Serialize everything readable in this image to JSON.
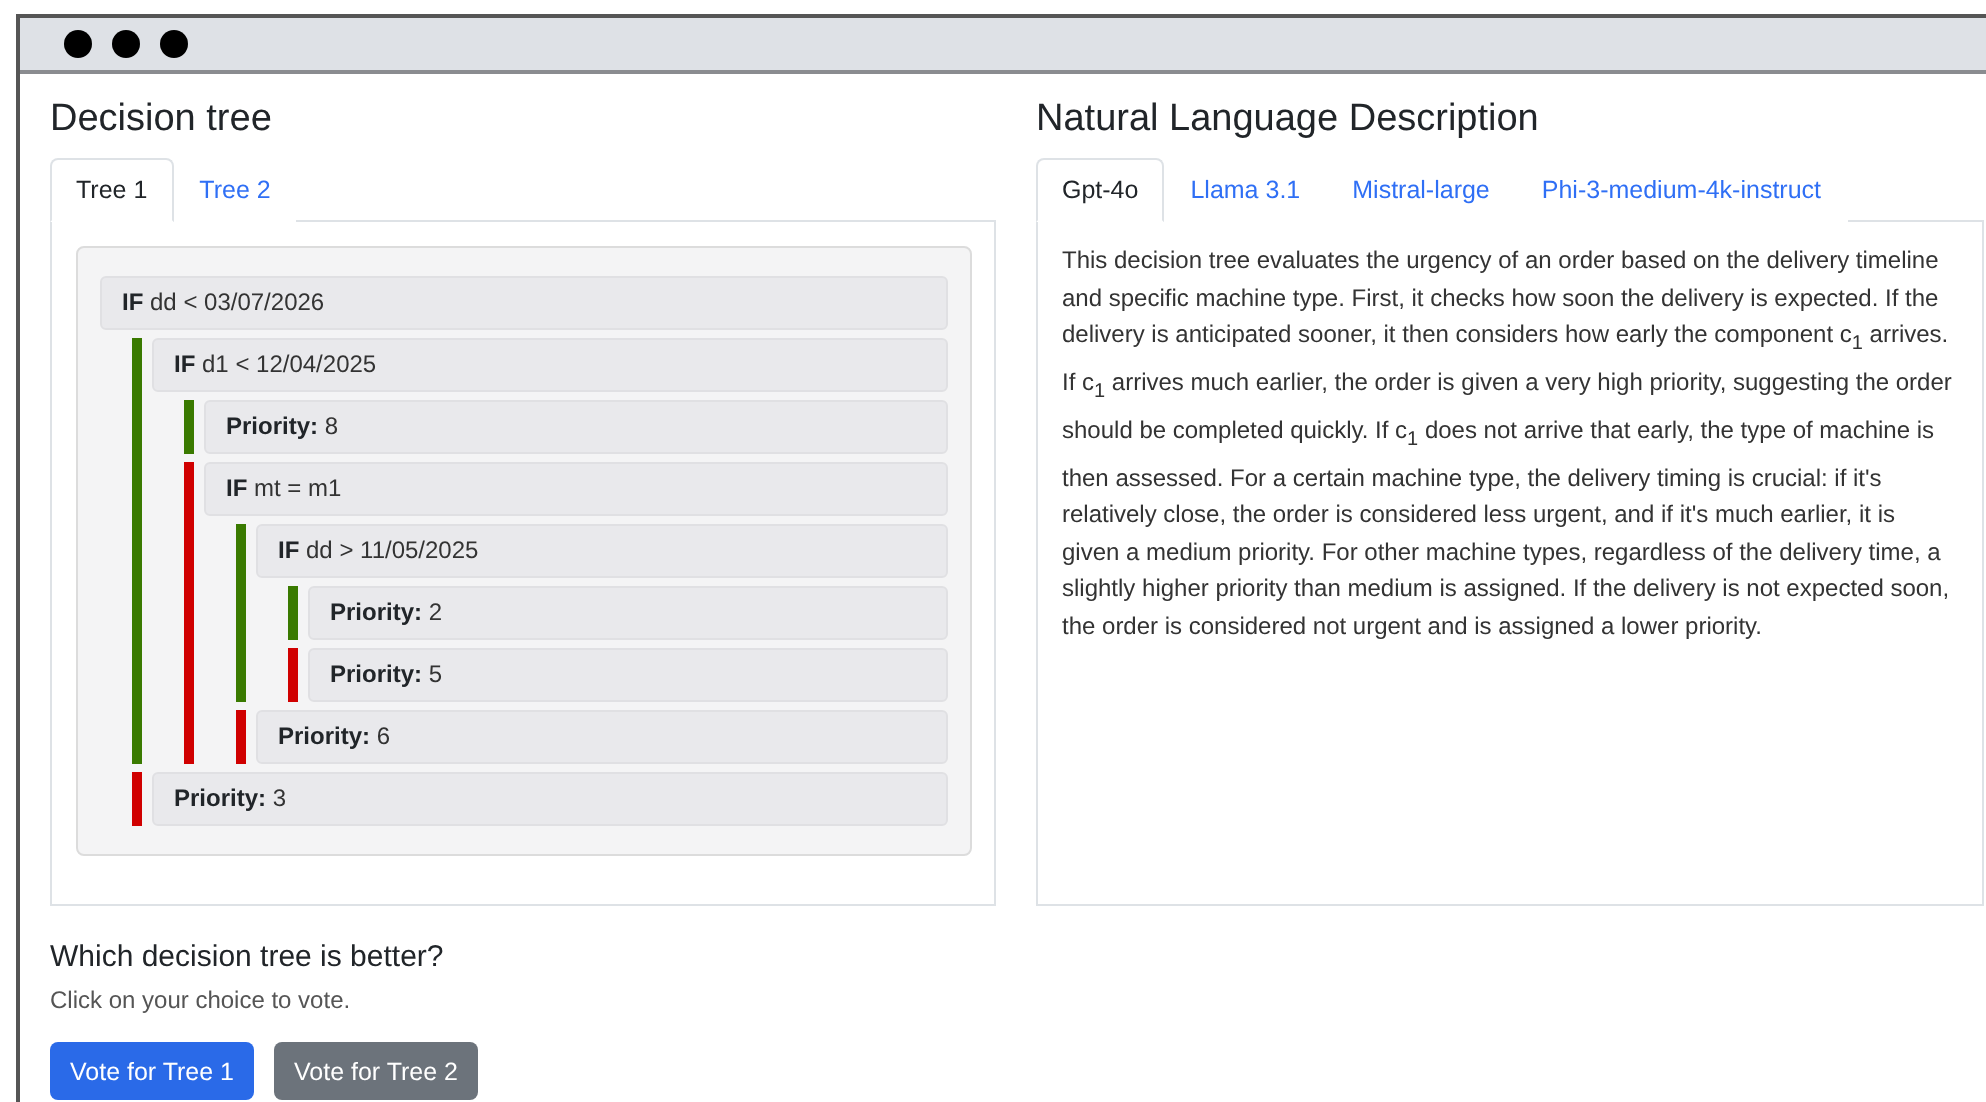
{
  "tree_panel": {
    "title": "Decision tree",
    "tabs": [
      {
        "label": "Tree 1",
        "selected": true
      },
      {
        "label": "Tree 2",
        "selected": false
      }
    ],
    "tree": {
      "text": "**IF** dd < 03/07/2026",
      "children": [
        {
          "color": "#3a7a00",
          "text": "**IF** d1 < 12/04/2025",
          "children": [
            {
              "color": "#3a7a00",
              "text": "**Priority:** 8"
            },
            {
              "color": "#d00000",
              "text": "**IF** mt = m1",
              "children": [
                {
                  "color": "#3a7a00",
                  "text": "**IF** dd > 11/05/2025",
                  "children": [
                    {
                      "color": "#3a7a00",
                      "text": "**Priority:** 2"
                    },
                    {
                      "color": "#d00000",
                      "text": "**Priority:** 5"
                    }
                  ]
                },
                {
                  "color": "#d00000",
                  "text": "**Priority:** 6"
                }
              ]
            }
          ]
        },
        {
          "color": "#d00000",
          "text": "**Priority:** 3"
        }
      ]
    }
  },
  "description_panel": {
    "title": "Natural Language Description",
    "tabs": [
      {
        "label": "Gpt-4o",
        "selected": true
      },
      {
        "label": "Llama 3.1",
        "selected": false
      },
      {
        "label": "Mistral-large",
        "selected": false
      },
      {
        "label": "Phi-3-medium-4k-instruct",
        "selected": false
      }
    ],
    "text": "This decision tree evaluates the urgency of an order based on the delivery timeline and specific machine type. First, it checks how soon the delivery is expected. If the delivery is anticipated sooner, it then considers how early the component c$_{1}$ arrives. If c$_{1}$ arrives much earlier, the order is given a very high priority, suggesting the order should be completed quickly. If c$_{1}$ does not arrive that early, the type of machine is then assessed. For a certain machine type, the delivery timing is crucial: if it's relatively close, the order is considered less urgent, and if it's much earlier, it is given a medium priority. For other machine types, regardless of the delivery time, a slightly higher priority than medium is assigned. If the delivery is not expected soon, the order is considered not urgent and is assigned a lower priority."
  },
  "vote": {
    "question": "Which decision tree is better?",
    "hint": "Click on your choice to vote.",
    "buttons": [
      {
        "label": "Vote for Tree 1",
        "kind": "primary"
      },
      {
        "label": "Vote for Tree 2",
        "kind": "secondary"
      }
    ]
  }
}
